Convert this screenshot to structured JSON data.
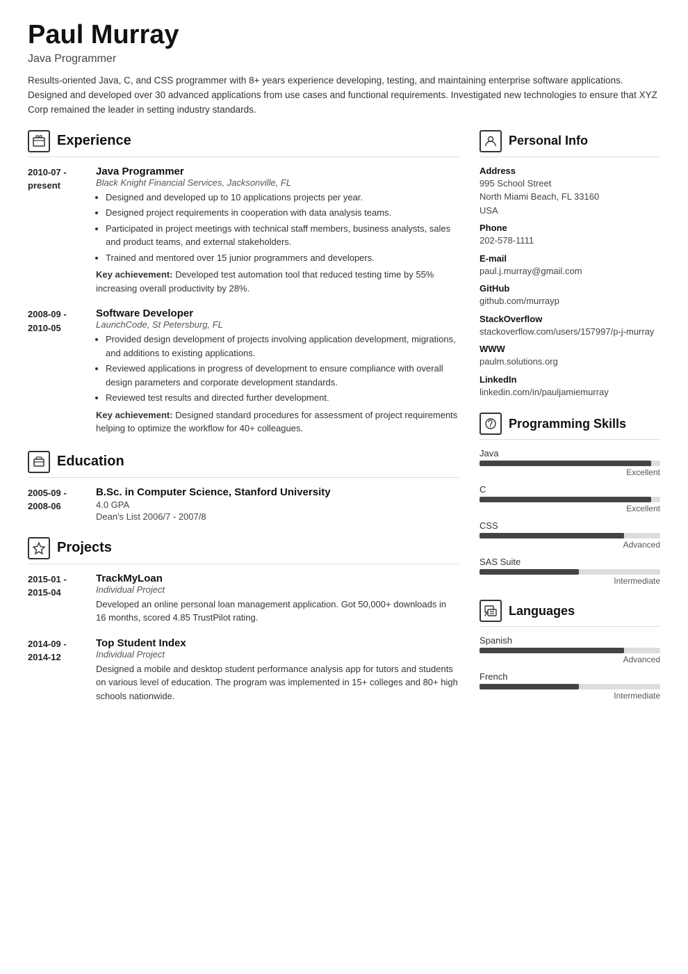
{
  "header": {
    "name": "Paul Murray",
    "subtitle": "Java Programmer",
    "summary": "Results-oriented Java, C, and CSS programmer with 8+ years experience developing, testing, and maintaining enterprise software applications. Designed and developed over 30 advanced applications from use cases and functional requirements. Investigated new technologies to ensure that XYZ Corp remained the leader in setting industry standards."
  },
  "experience": {
    "section_title": "Experience",
    "entries": [
      {
        "date_start": "2010-07 -",
        "date_end": "present",
        "title": "Java Programmer",
        "org": "Black Knight Financial Services, Jacksonville, FL",
        "bullets": [
          "Designed and developed up to 10 applications projects per year.",
          "Designed project requirements in cooperation with data analysis teams.",
          "Participated in project meetings with technical staff members, business analysts, sales and product teams, and external stakeholders.",
          "Trained and mentored over 15 junior programmers and developers."
        ],
        "achievement": "Key achievement: Developed test automation tool that reduced testing time by 55% increasing overall productivity by 28%."
      },
      {
        "date_start": "2008-09 -",
        "date_end": "2010-05",
        "title": "Software Developer",
        "org": "LaunchCode, St Petersburg, FL",
        "bullets": [
          "Provided design development of projects involving application development, migrations, and additions to existing applications.",
          "Reviewed applications in progress of development to ensure compliance with overall design parameters and corporate development standards.",
          "Reviewed test results and directed further development."
        ],
        "achievement": "Key achievement: Designed standard procedures for assessment of project requirements helping to optimize the workflow for 40+ colleagues."
      }
    ]
  },
  "education": {
    "section_title": "Education",
    "entries": [
      {
        "date_start": "2005-09 -",
        "date_end": "2008-06",
        "title": "B.Sc. in Computer Science, Stanford University",
        "sub1": "4.0 GPA",
        "sub2": "Dean's List 2006/7 - 2007/8"
      }
    ]
  },
  "projects": {
    "section_title": "Projects",
    "entries": [
      {
        "date_start": "2015-01 -",
        "date_end": "2015-04",
        "title": "TrackMyLoan",
        "org": "Individual Project",
        "description": "Developed an online personal loan management application. Got 50,000+ downloads in 16 months, scored 4.85 TrustPilot rating."
      },
      {
        "date_start": "2014-09 -",
        "date_end": "2014-12",
        "title": "Top Student Index",
        "org": "Individual Project",
        "description": "Designed a mobile and desktop student performance analysis app for tutors and students on various level of education. The program was implemented in 15+ colleges and 80+ high schools nationwide."
      }
    ]
  },
  "personal_info": {
    "section_title": "Personal Info",
    "fields": [
      {
        "label": "Address",
        "value": "995 School Street\nNorth Miami Beach, FL 33160\nUSA"
      },
      {
        "label": "Phone",
        "value": "202-578-1111"
      },
      {
        "label": "E-mail",
        "value": "paul.j.murray@gmail.com"
      },
      {
        "label": "GitHub",
        "value": "github.com/murrayp"
      },
      {
        "label": "StackOverflow",
        "value": "stackoverflow.com/users/157997/p-j-murray"
      },
      {
        "label": "WWW",
        "value": "paulm.solutions.org"
      },
      {
        "label": "LinkedIn",
        "value": "linkedin.com/in/pauljamiemurray"
      }
    ]
  },
  "skills": {
    "section_title": "Programming Skills",
    "items": [
      {
        "name": "Java",
        "level": "Excellent",
        "percent": 95
      },
      {
        "name": "C",
        "level": "Excellent",
        "percent": 95
      },
      {
        "name": "CSS",
        "level": "Advanced",
        "percent": 80
      },
      {
        "name": "SAS Suite",
        "level": "Intermediate",
        "percent": 55
      }
    ]
  },
  "languages": {
    "section_title": "Languages",
    "items": [
      {
        "name": "Spanish",
        "level": "Advanced",
        "percent": 80
      },
      {
        "name": "French",
        "level": "Intermediate",
        "percent": 55
      }
    ]
  },
  "icons": {
    "experience": "🗂",
    "education": "🎓",
    "projects": "⭐",
    "personal_info": "👤",
    "skills": "🔧",
    "languages": "🚩"
  }
}
